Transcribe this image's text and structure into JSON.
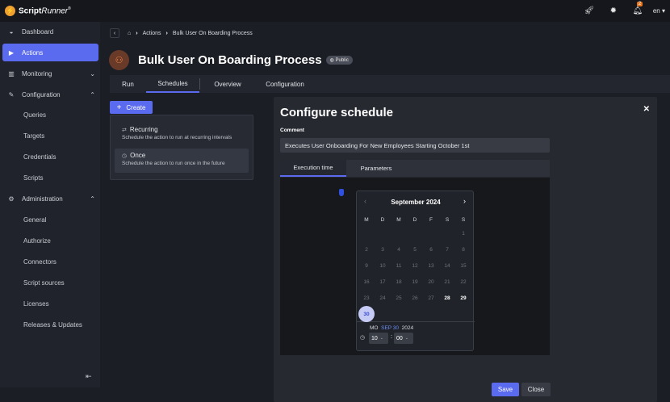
{
  "app": {
    "logo_text_bold": "Script",
    "logo_text_italic": "Runner",
    "logo_reg": "®",
    "language": "en"
  },
  "topbar": {
    "notification_count": "2"
  },
  "sidebar": {
    "items": [
      {
        "label": "Dashboard",
        "icon": "dashboard-icon"
      },
      {
        "label": "Actions",
        "icon": "play-icon"
      },
      {
        "label": "Monitoring",
        "icon": "chart-icon"
      },
      {
        "label": "Configuration",
        "icon": "wrench-icon"
      },
      {
        "label": "Administration",
        "icon": "gear-icon"
      }
    ],
    "config_sub": [
      "Queries",
      "Targets",
      "Credentials",
      "Scripts"
    ],
    "admin_sub": [
      "General",
      "Authorize",
      "Connectors",
      "Script sources",
      "Licenses",
      "Releases & Updates"
    ]
  },
  "breadcrumb": {
    "item1": "Actions",
    "item2": "Bulk User On Boarding Process"
  },
  "page": {
    "title": "Bulk User On Boarding Process",
    "badge": "Public"
  },
  "tabs": [
    "Run",
    "Schedules",
    "Overview",
    "Configuration"
  ],
  "create": {
    "label": "Create",
    "options": [
      {
        "title": "Recurring",
        "desc": "Schedule the action to run at recurring intervals"
      },
      {
        "title": "Once",
        "desc": "Schedule the action to run once in the future"
      }
    ]
  },
  "dialog": {
    "title": "Configure schedule",
    "comment_label": "Comment",
    "comment_value": "Executes User Onboarding For New Employees Starting October 1st",
    "tabs": [
      "Execution time",
      "Parameters"
    ],
    "save": "Save",
    "close": "Close"
  },
  "calendar": {
    "month": "September 2024",
    "weekdays": [
      "M",
      "D",
      "M",
      "D",
      "F",
      "S",
      "S"
    ],
    "weeks": [
      [
        "",
        "",
        "",
        "",
        "",
        "",
        "1"
      ],
      [
        "2",
        "3",
        "4",
        "5",
        "6",
        "7",
        "8"
      ],
      [
        "9",
        "10",
        "11",
        "12",
        "13",
        "14",
        "15"
      ],
      [
        "16",
        "17",
        "18",
        "19",
        "20",
        "21",
        "22"
      ],
      [
        "23",
        "24",
        "25",
        "26",
        "27",
        "28",
        "29"
      ],
      [
        "30",
        "",
        "",
        "",
        "",
        "",
        ""
      ]
    ],
    "available": [
      "28",
      "29"
    ],
    "selected": "30",
    "date_weekday": "MO",
    "date_highlight": "SEP 30",
    "date_year": "2024",
    "hour": "10",
    "minute": "00"
  }
}
